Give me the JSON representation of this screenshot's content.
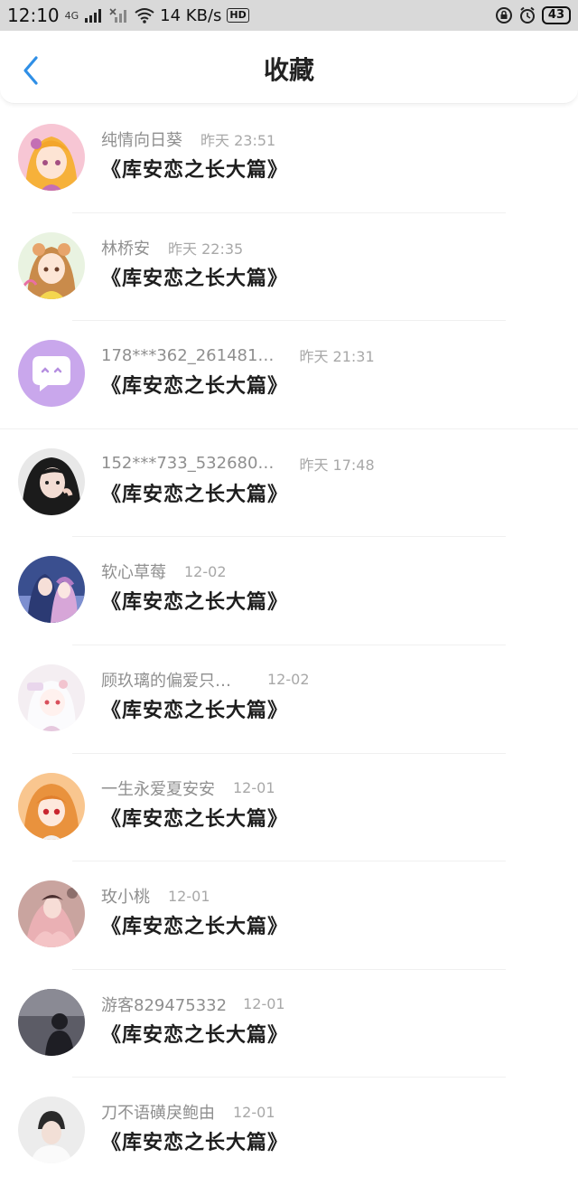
{
  "status_bar": {
    "time": "12:10",
    "network_type": "4G",
    "speed": "14 KB/s",
    "hd_label": "HD",
    "battery": "43"
  },
  "header": {
    "title": "收藏"
  },
  "colors": {
    "accent": "#2f8fe6",
    "status_bar_bg": "#d9d9d9",
    "meta_text": "#8f8f8f",
    "title_text": "#1e1e1e"
  },
  "items": [
    {
      "user": "纯情向日葵",
      "time": "昨天 23:51",
      "title": "《库安恋之长大篇》",
      "avatar_icon": "avatar-anime-girl-pink"
    },
    {
      "user": "林桥安",
      "time": "昨天 22:35",
      "title": "《库安恋之长大篇》",
      "avatar_icon": "avatar-anime-girl-yellow"
    },
    {
      "user": "178***362_261481…",
      "time": "昨天 21:31",
      "title": "《库安恋之长大篇》",
      "avatar_icon": "avatar-default-chat-bubble"
    },
    {
      "user": "152***733_532680…",
      "time": "昨天 17:48",
      "title": "《库安恋之长大篇》",
      "avatar_icon": "avatar-photo-girl"
    },
    {
      "user": "软心草莓",
      "time": "12-02",
      "title": "《库安恋之长大篇》",
      "avatar_icon": "avatar-anime-couple"
    },
    {
      "user": "顾玖璃的偏爱只…",
      "time": "12-02",
      "title": "《库安恋之长大篇》",
      "avatar_icon": "avatar-anime-white-hair"
    },
    {
      "user": "一生永爱夏安安",
      "time": "12-01",
      "title": "《库安恋之长大篇》",
      "avatar_icon": "avatar-anime-girl-orange"
    },
    {
      "user": "玫小桃",
      "time": "12-01",
      "title": "《库安恋之长大篇》",
      "avatar_icon": "avatar-anime-pink-dress"
    },
    {
      "user": "游客829475332",
      "time": "12-01",
      "title": "《库安恋之长大篇》",
      "avatar_icon": "avatar-silhouette-dark"
    },
    {
      "user": "刀不语磺戾鲍由",
      "time": "12-01",
      "title": "《库安恋之长大篇》",
      "avatar_icon": "avatar-photo-boy"
    }
  ]
}
